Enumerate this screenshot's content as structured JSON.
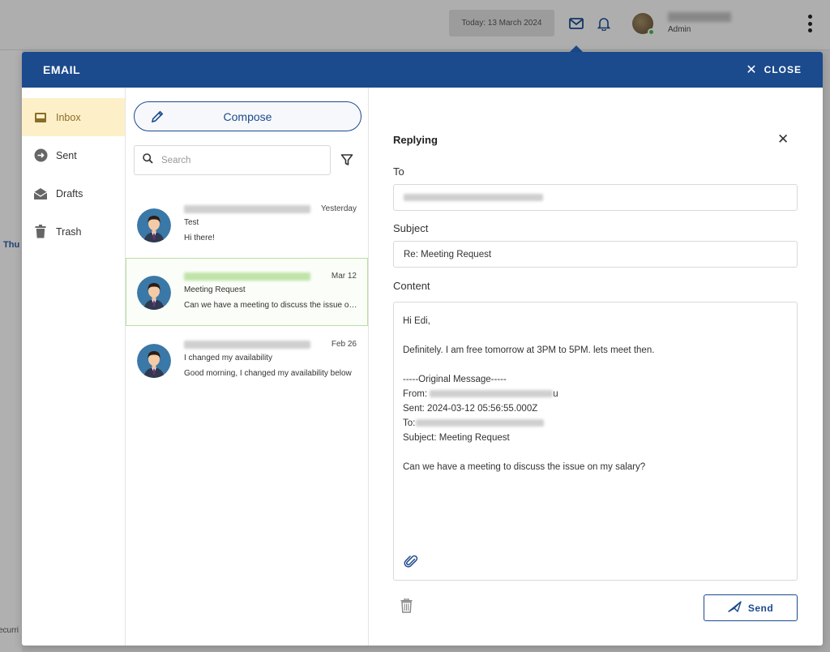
{
  "topbar": {
    "date_label": "Today: 13 March 2024",
    "user_role": "Admin"
  },
  "background": {
    "partial_tab": "Thu",
    "partial_text": "ecurri"
  },
  "modal": {
    "title": "EMAIL",
    "close_label": "CLOSE"
  },
  "folders": [
    {
      "label": "Inbox",
      "icon": "inbox-icon"
    },
    {
      "label": "Sent",
      "icon": "sent-icon"
    },
    {
      "label": "Drafts",
      "icon": "drafts-icon"
    },
    {
      "label": "Trash",
      "icon": "trash-icon"
    }
  ],
  "list": {
    "compose_label": "Compose",
    "search_placeholder": "Search",
    "messages": [
      {
        "date": "Yesterday",
        "subject": "Test",
        "preview": "Hi there!"
      },
      {
        "date": "Mar 12",
        "subject": "Meeting Request",
        "preview": "Can we have a meeting to discuss the issue on my salary?"
      },
      {
        "date": "Feb 26",
        "subject": "I changed my availability",
        "preview": "Good morning, I changed my availability below"
      }
    ]
  },
  "reply": {
    "title": "Replying",
    "to_label": "To",
    "subject_label": "Subject",
    "subject_value": "Re: Meeting Request",
    "content_label": "Content",
    "content": {
      "greeting": "Hi Edi,",
      "body": "Definitely. I am free tomorrow at 3PM to 5PM. lets meet then.",
      "orig_header": "-----Original Message-----",
      "from_prefix": "From:",
      "from_suffix": "u",
      "sent_line": "Sent: 2024-03-12 05:56:55.000Z",
      "to_prefix": "To:",
      "subject_line": "Subject: Meeting Request",
      "orig_body": "Can we have a meeting to discuss the issue on my salary?"
    },
    "send_label": "Send"
  },
  "colors": {
    "brand": "#1b4a8d",
    "active_folder_bg": "#fdf0c8",
    "selected_border": "#b9df9f"
  }
}
